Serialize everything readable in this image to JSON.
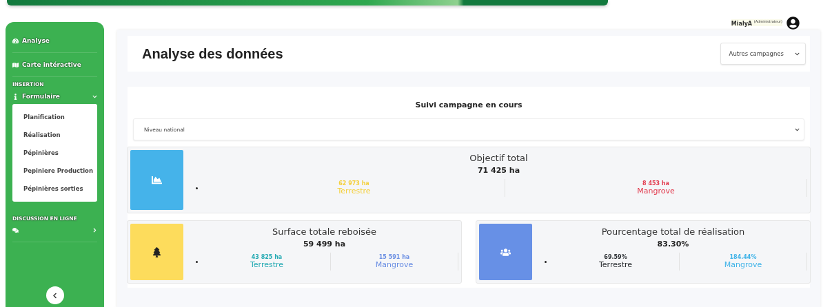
{
  "user": {
    "name": "MialyA",
    "role": "(Administrateur)"
  },
  "sidebar": {
    "items": [
      {
        "kind": "link",
        "label": "Analyse"
      },
      {
        "kind": "link",
        "label": "Carte intéractive"
      },
      {
        "kind": "section",
        "label": "INSERTION"
      },
      {
        "kind": "menu",
        "label": "Formulaire",
        "expanded": true,
        "children": [
          {
            "label": "Planification"
          },
          {
            "label": "Réalisation"
          },
          {
            "label": "Pépinières"
          },
          {
            "label": "Pepiniere Production"
          },
          {
            "label": "Pépinières sorties"
          }
        ]
      },
      {
        "kind": "section",
        "label": "DISCUSSION EN LIGNE"
      },
      {
        "kind": "menu",
        "expanded": false
      }
    ]
  },
  "header": {
    "title": "Analyse des données",
    "campaign_select": "Autres campagnes"
  },
  "tracking": {
    "title": "Suivi campagne en cours",
    "level_select": "Niveau national",
    "cards": [
      {
        "color": "#45b3ea",
        "title": "Objectif total",
        "total": "71 425 ha",
        "parts": [
          {
            "value": "62 973 ha",
            "label": "Terrestre",
            "color": "#f4d03f"
          },
          {
            "value": "8 453 ha",
            "label": "Mangrove",
            "color": "#e23b4e"
          }
        ]
      },
      {
        "color": "#fddc5c",
        "title": "Surface totale reboisée",
        "total": "59 499 ha",
        "parts": [
          {
            "value": "43 825 ha",
            "label": "Terrestre",
            "color": "#25aab3"
          },
          {
            "value": "15 591 ha",
            "label": "Mangrove",
            "color": "#6b8fe3"
          }
        ]
      },
      {
        "color": "#6790e6",
        "title": "Pourcentage total de réalisation",
        "total": "83.30%",
        "parts": [
          {
            "value": "69.59%",
            "label": "Terrestre",
            "color": "#2b2f33"
          },
          {
            "value": "184.44%",
            "label": "Mangrove",
            "color": "#3fb3e8"
          }
        ]
      }
    ]
  }
}
